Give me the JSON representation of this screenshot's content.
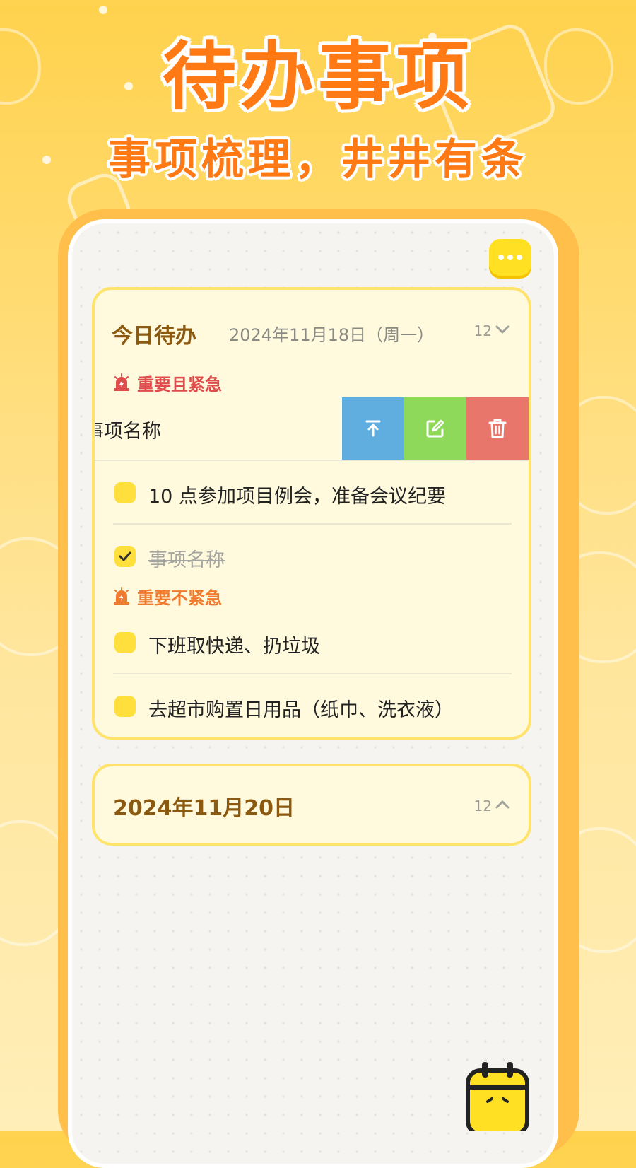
{
  "hero": {
    "title": "待办事项",
    "subtitle": "事项梳理，井井有条"
  },
  "colors": {
    "accent": "#ff7a14",
    "yellow": "#ffdf3c",
    "urgent_red": "#e04b4b",
    "important_orange": "#f07b2e",
    "pin_blue": "#60addf",
    "edit_green": "#8ed95a",
    "delete_red": "#e8766a"
  },
  "today": {
    "title": "今日待办",
    "date": "2024年11月18日（周一）",
    "count": "12",
    "sections": [
      {
        "label": "重要且紧急",
        "icon": "alarm-icon"
      },
      {
        "label": "重要不紧急",
        "icon": "alarm-icon"
      }
    ],
    "swipe_item": {
      "text": "事项名称",
      "actions": [
        "pin-top-icon",
        "edit-icon",
        "trash-icon"
      ]
    },
    "items": [
      {
        "text": "10 点参加项目例会，准备会议纪要",
        "checked": false
      },
      {
        "text": "事项名称",
        "checked": true
      },
      {
        "text": "下班取快递、扔垃圾",
        "checked": false
      },
      {
        "text": "去超市购置日用品（纸巾、洗衣液）",
        "checked": false
      }
    ]
  },
  "later": {
    "title": "2024年11月20日",
    "count": "12"
  }
}
